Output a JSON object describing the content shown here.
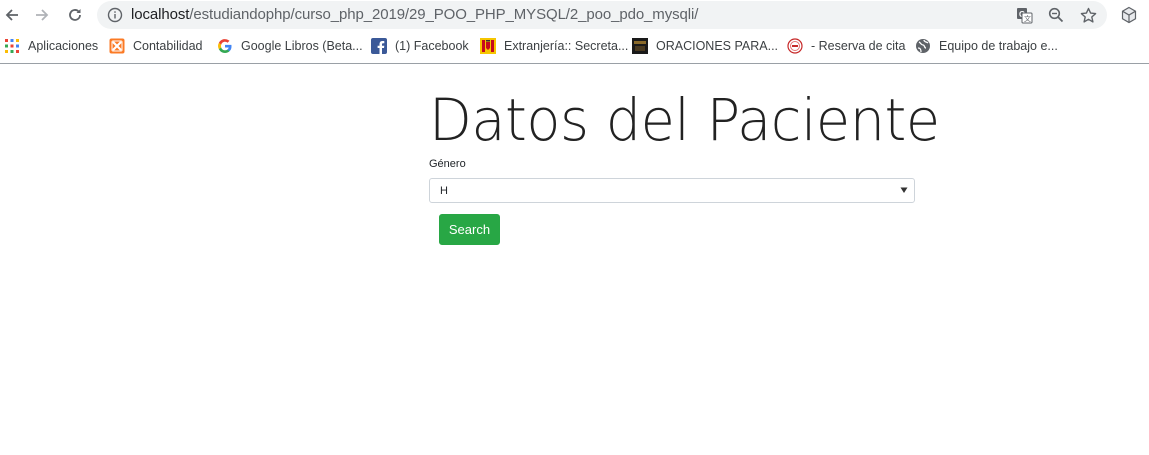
{
  "browser": {
    "url_host": "localhost",
    "url_path": "/estudiandophp/curso_php_2019/29_POO_PHP_MYSQL/2_poo_pdo_mysqli/",
    "icons": {
      "back": "arrow-left-icon",
      "forward": "arrow-right-icon",
      "reload": "reload-icon",
      "info": "info-icon",
      "translate": "translate-icon",
      "zoom": "zoom-out-icon",
      "star": "star-icon",
      "extension": "cube-icon"
    }
  },
  "bookmarks": [
    {
      "label": "Aplicaciones",
      "icon": "apps-grid-icon"
    },
    {
      "label": "Contabilidad",
      "icon": "xampp-icon",
      "color": "#fb7a24"
    },
    {
      "label": "Google Libros (Beta...",
      "icon": "google-icon"
    },
    {
      "label": "(1) Facebook",
      "icon": "facebook-icon",
      "color": "#3b5998"
    },
    {
      "label": "Extranjería:: Secreta...",
      "icon": "spain-crest-icon"
    },
    {
      "label": "ORACIONES PARA...",
      "icon": "dark-thumbnail-icon"
    },
    {
      "label": "- Reserva de cita",
      "icon": "seal-icon"
    },
    {
      "label": "Equipo de trabajo e...",
      "icon": "globe-icon"
    }
  ],
  "page": {
    "title": "Datos del Paciente",
    "gender_label": "Género",
    "gender_selected": "H",
    "search_label": "Search",
    "search_color": "#28a745"
  }
}
